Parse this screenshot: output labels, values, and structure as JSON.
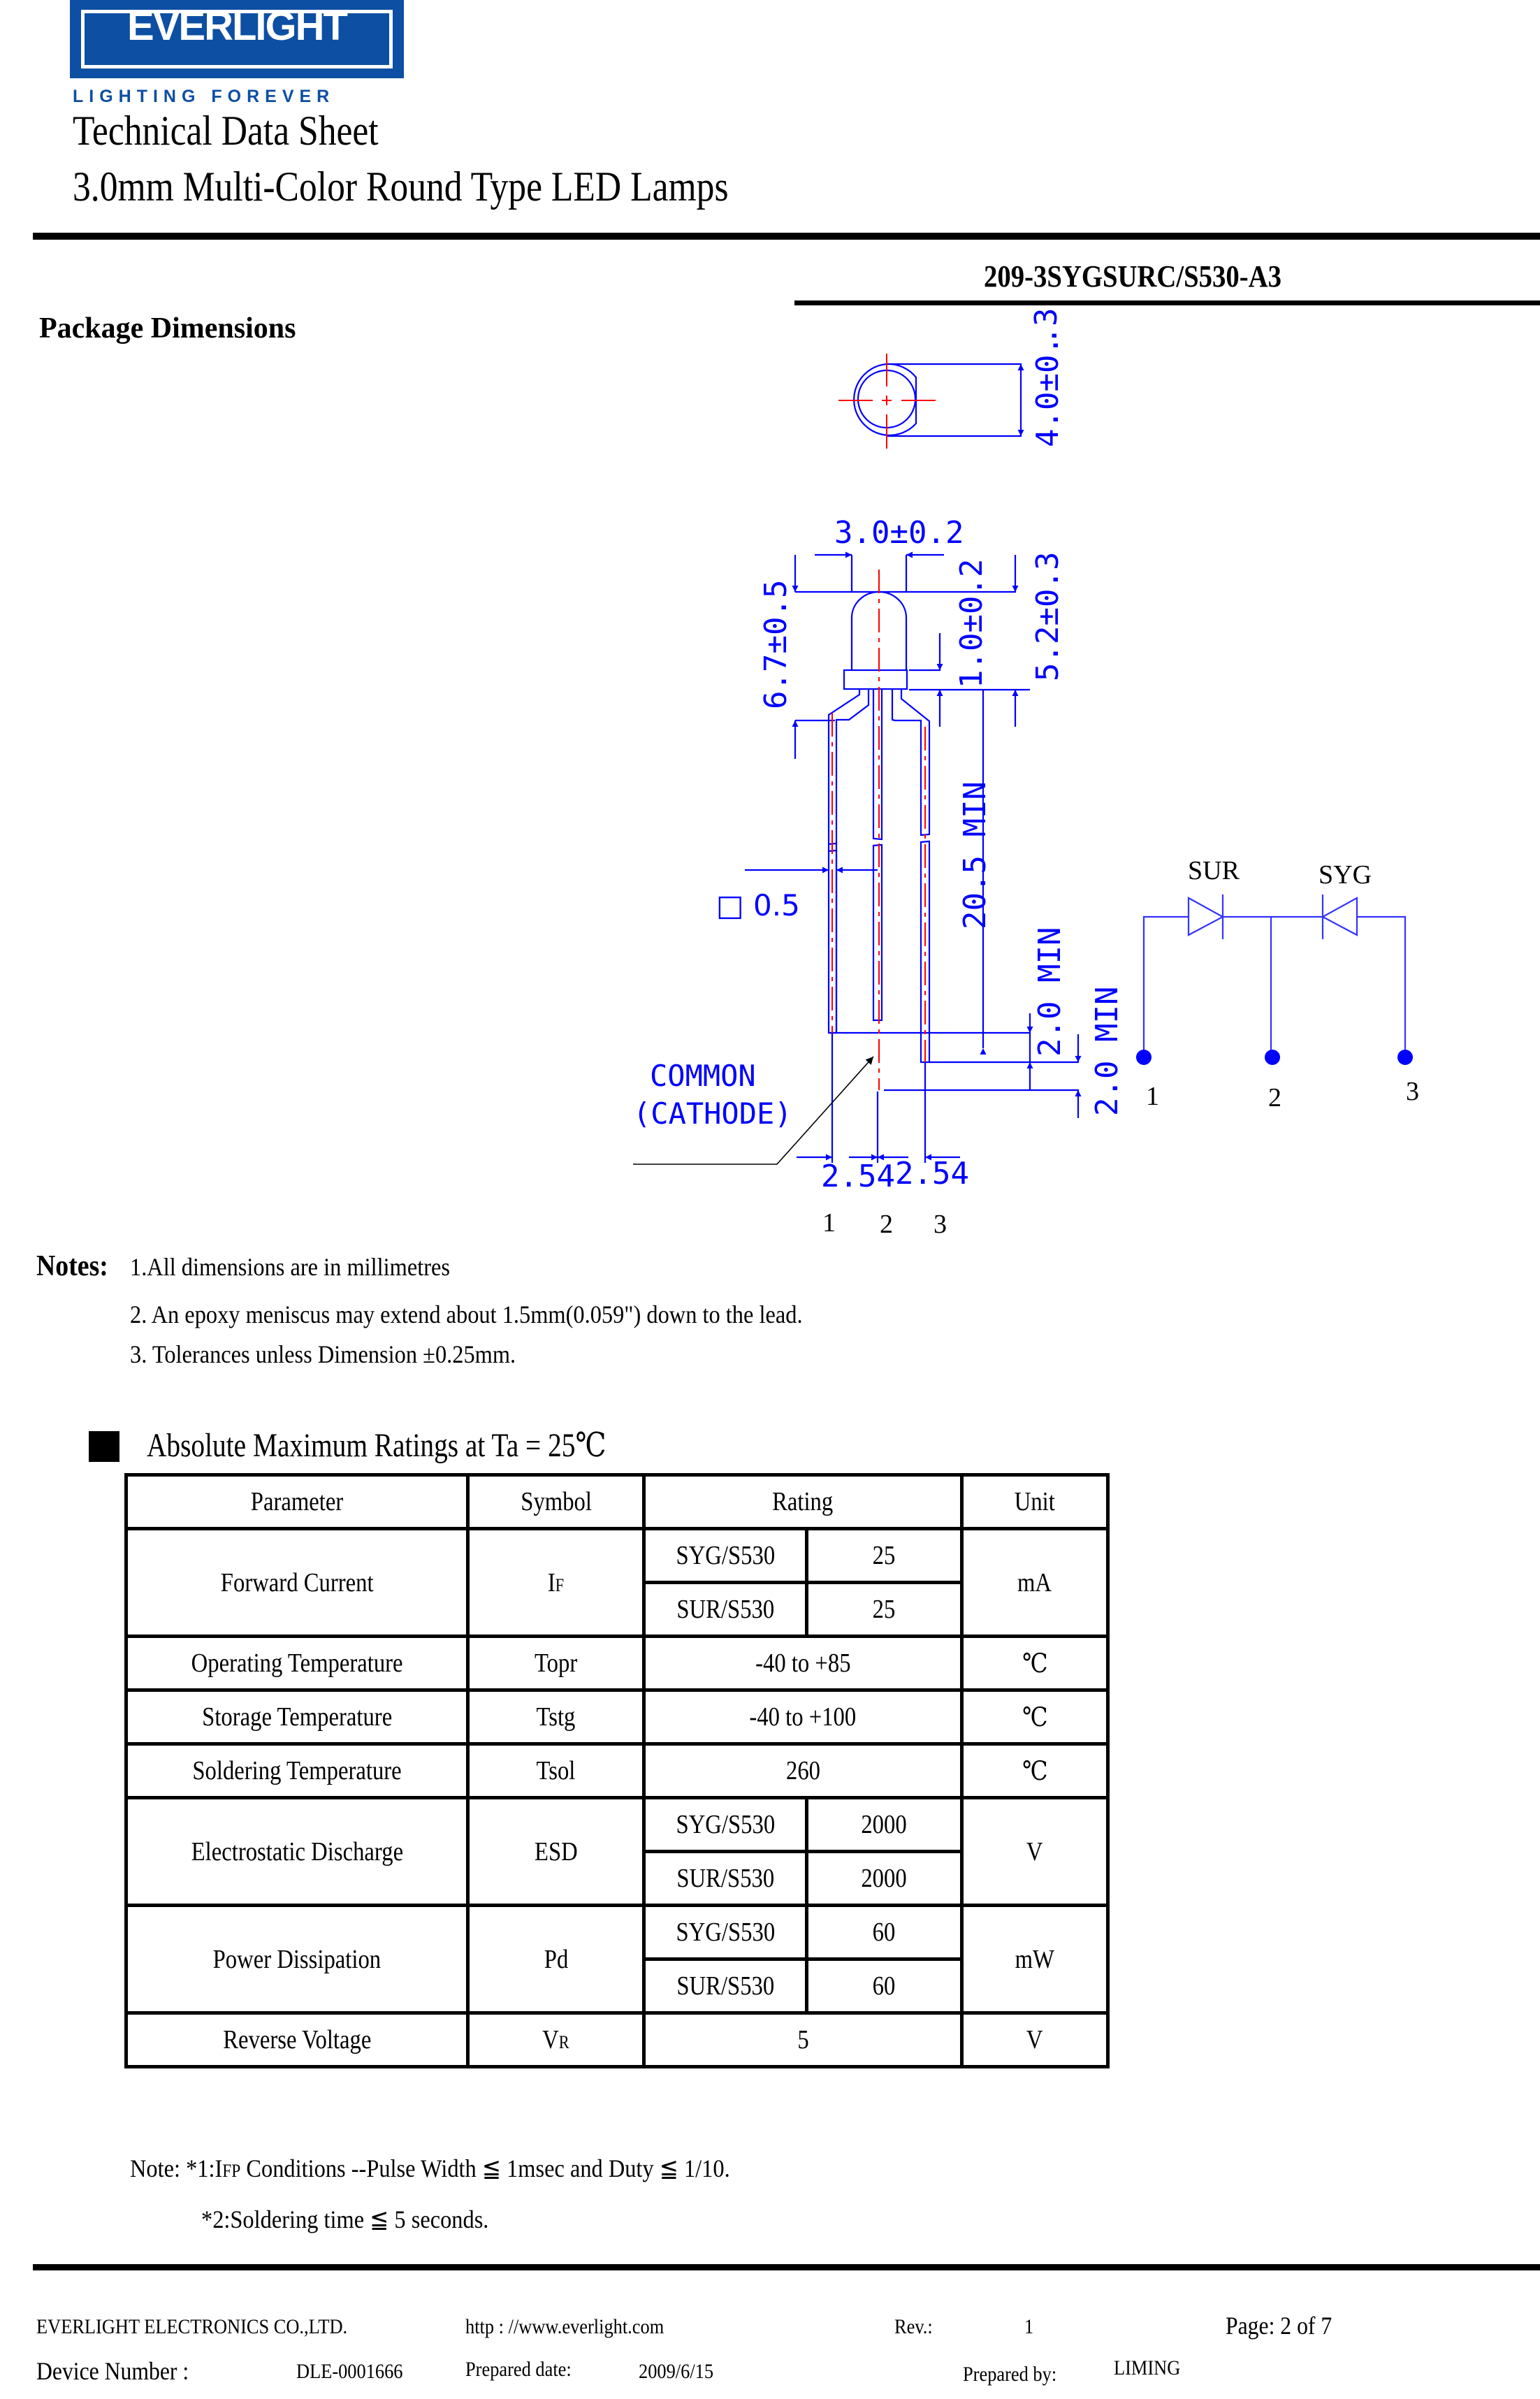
{
  "header": {
    "logo_text": "EVERLIGHT",
    "tagline": "LIGHTING FOREVER",
    "title": "Technical Data Sheet",
    "subtitle": "3.0mm Multi-Color Round Type LED Lamps",
    "part_number": "209-3SYGSURC/S530-A3"
  },
  "package": {
    "title": "Package Dimensions",
    "dimensions": {
      "flange_diameter": "4.0±0.3",
      "body_diameter": "3.0±0.2",
      "total_height": "6.7±0.5",
      "flange_height": "1.0±0.2",
      "body_height": "5.2±0.3",
      "lead_length": "20.5  MIN",
      "lead_offset_1": "2.0  MIN",
      "lead_offset_2": "2.0  MIN",
      "lead_square": "□ 0.5",
      "pitch_left": "2.54",
      "pitch_right": "2.54",
      "common_label_1": "COMMON",
      "common_label_2": "(CATHODE)"
    },
    "pin_labels": [
      "1",
      "2",
      "3"
    ],
    "circuit": {
      "diode_left": "SUR",
      "diode_right": "SYG",
      "pins": [
        "1",
        "2",
        "3"
      ]
    },
    "colors": {
      "drawing": "#0000ff",
      "centerline": "#ff0000"
    }
  },
  "notes": {
    "label": "Notes:",
    "items": [
      "1.All dimensions are in millimetres",
      "2. An epoxy meniscus may extend about 1.5mm(0.059\") down to the lead.",
      "3. Tolerances unless  Dimension  ±0.25mm."
    ]
  },
  "ratings": {
    "title": "Absolute Maximum Ratings at Ta = 25℃",
    "headers": {
      "parameter": "Parameter",
      "symbol": "Symbol",
      "rating": "Rating",
      "unit": "Unit"
    },
    "rows": [
      {
        "parameter": "Forward  Current",
        "symbol": "I",
        "symbol_sub": "F",
        "unit": "mA",
        "sub": [
          {
            "device": "SYG/S530",
            "value": "25"
          },
          {
            "device": "SUR/S530",
            "value": "25"
          }
        ]
      },
      {
        "parameter": "Operating Temperature",
        "symbol": "Topr",
        "value": "-40 to +85",
        "unit": "℃"
      },
      {
        "parameter": "Storage Temperature",
        "symbol": "Tstg",
        "value": "-40 to +100",
        "unit": "℃"
      },
      {
        "parameter": "Soldering Temperature",
        "symbol": "Tsol",
        "value": "260",
        "unit": "℃"
      },
      {
        "parameter": "Electrostatic Discharge",
        "symbol": "ESD",
        "unit": "V",
        "sub": [
          {
            "device": "SYG/S530",
            "value": "2000"
          },
          {
            "device": "SUR/S530",
            "value": "2000"
          }
        ]
      },
      {
        "parameter": "Power Dissipation",
        "symbol": "Pd",
        "unit": "mW",
        "sub": [
          {
            "device": "SYG/S530",
            "value": "60"
          },
          {
            "device": "SUR/S530",
            "value": "60"
          }
        ]
      },
      {
        "parameter": "Reverse Voltage",
        "symbol": "V",
        "symbol_sub": "R",
        "value": "5",
        "unit": "V"
      }
    ],
    "notes": {
      "n1_prefix": "Note:  *1:I",
      "n1_sub": "FP",
      "n1_text": "  Conditions --Pulse  Width ≦  1msec  and  Duty  ≦  1/10.",
      "n2": "*2:Soldering  time  ≦  5 seconds."
    }
  },
  "footer": {
    "company": "EVERLIGHT ELECTRONICS CO.,LTD.",
    "url": "http : //www.everlight.com",
    "rev_label": "Rev.:",
    "rev_value": "1",
    "page": "Page: 2  of  7",
    "device_label": "Device  Number :",
    "device_value": "DLE-0001666",
    "prepared_date_label": "Prepared date:",
    "prepared_date_value": "2009/6/15",
    "prepared_by_label": "Prepared by:",
    "prepared_by_value": "LIMING"
  }
}
